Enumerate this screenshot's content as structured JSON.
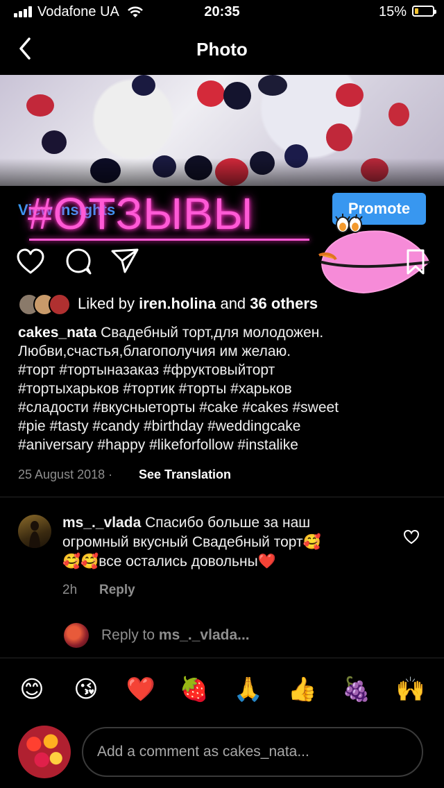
{
  "status_bar": {
    "carrier": "Vodafone UA",
    "time": "20:35",
    "battery": "15%"
  },
  "nav": {
    "title": "Photo"
  },
  "post": {
    "insights_label": "View Insights",
    "promote_label": "Promote",
    "sticker_text": "#ОТЗЫВЫ",
    "liked_prefix": "Liked by",
    "liked_user": "iren.holina",
    "liked_and": "and",
    "liked_others": "36 others",
    "author": "cakes_nata",
    "caption_lines": [
      "Свадебный торт,для молодожен.",
      "Любви,счастья,благополучия им желаю.",
      "#торт #тортыназаказ #фруктовыйторт",
      "#тортыхарьков #тортик #торты  #харьков",
      "#сладости #вкусныеторты #cake #cakes #sweet",
      "#pie #tasty #candy #birthday #weddingcake",
      "#aniversary #happy #likeforfollow #instalike"
    ],
    "date": "25 August 2018",
    "separator": "·",
    "see_translation": "See Translation"
  },
  "comment": {
    "user": "ms_._vlada",
    "line1": "Спасибо больше за наш",
    "line2": "огромный вкусный Свадебный торт🥰",
    "line3": "🥰🥰все остались довольны❤️",
    "age": "2h",
    "reply_label": "Reply"
  },
  "reply_to": {
    "prefix": "Reply to",
    "user": "ms_._vlada..."
  },
  "emoji_bar": [
    "😊",
    "😘",
    "❤️",
    "🍓",
    "🙏",
    "👍",
    "🍇",
    "🙌"
  ],
  "comment_input": {
    "placeholder": "Add a comment as cakes_nata..."
  },
  "colors": {
    "accent": "#3897f0",
    "sticker": "#ff5ad6",
    "muted": "#8e8e8e",
    "background": "#000000"
  }
}
